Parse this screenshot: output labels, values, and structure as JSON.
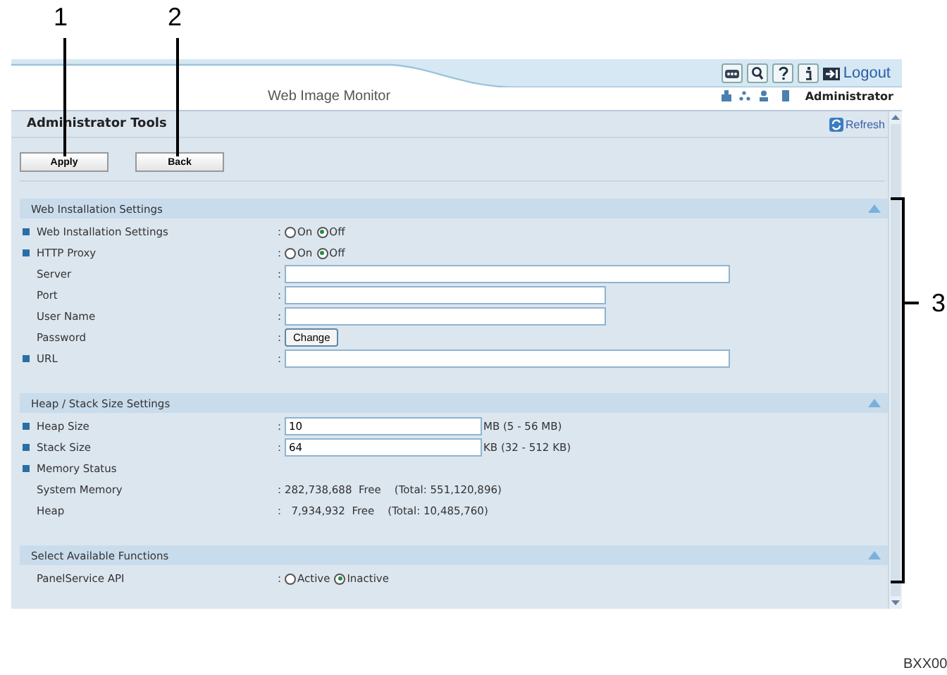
{
  "header": {
    "title": "Web Image Monitor",
    "logout": "Logout",
    "user": "Administrator"
  },
  "page": {
    "title": "Administrator Tools",
    "refresh": "Refresh"
  },
  "buttons": [
    "Apply",
    "Back"
  ],
  "sections": [
    {
      "title": "Web Installation Settings",
      "rows": [
        {
          "kind": "radio",
          "label": "Web Installation Settings",
          "bullet": true,
          "sep": ":",
          "options": [
            {
              "label": "On",
              "selected": false
            },
            {
              "label": "Off",
              "selected": true
            }
          ]
        },
        {
          "kind": "radio",
          "label": "HTTP Proxy",
          "bullet": true,
          "sep": ":",
          "options": [
            {
              "label": "On",
              "selected": false
            },
            {
              "label": "Off",
              "selected": true
            }
          ]
        },
        {
          "kind": "wide",
          "label": "Server",
          "bullet": false,
          "sep": ":"
        },
        {
          "kind": "narrow",
          "label": "Port",
          "bullet": false,
          "sep": ":"
        },
        {
          "kind": "narrow",
          "label": "User Name",
          "bullet": false,
          "sep": ":"
        },
        {
          "kind": "button",
          "label": "Password",
          "bullet": false,
          "sep": ":",
          "button": "Change"
        },
        {
          "kind": "wide",
          "label": "URL",
          "bullet": true,
          "sep": ":"
        }
      ]
    },
    {
      "title": "Heap / Stack Size Settings",
      "rows": [
        {
          "kind": "short",
          "label": "Heap Size",
          "bullet": true,
          "sep": ":",
          "value": "10",
          "unit": "MB (5 - 56 MB)"
        },
        {
          "kind": "short",
          "label": "Stack Size",
          "bullet": true,
          "sep": ":",
          "value": "64",
          "unit": "KB (32 - 512 KB)"
        },
        {
          "kind": "heading",
          "label": "Memory Status",
          "bullet": true
        },
        {
          "kind": "info",
          "label": "System Memory",
          "bullet": false,
          "sep": ":",
          "value": "282,738,688  Free    (Total: 551,120,896)"
        },
        {
          "kind": "info",
          "label": "Heap",
          "bullet": false,
          "sep": ":",
          "value": "  7,934,932  Free    (Total: 10,485,760)"
        }
      ]
    },
    {
      "title": "Select Available Functions",
      "rows": [
        {
          "kind": "radio",
          "label": "PanelService API",
          "bullet": false,
          "sep": ":",
          "options": [
            {
              "label": "Active",
              "selected": false
            },
            {
              "label": "Inactive",
              "selected": true
            }
          ]
        }
      ]
    }
  ],
  "callouts": [
    "1",
    "2",
    "3"
  ],
  "figure_id": "BXX00"
}
